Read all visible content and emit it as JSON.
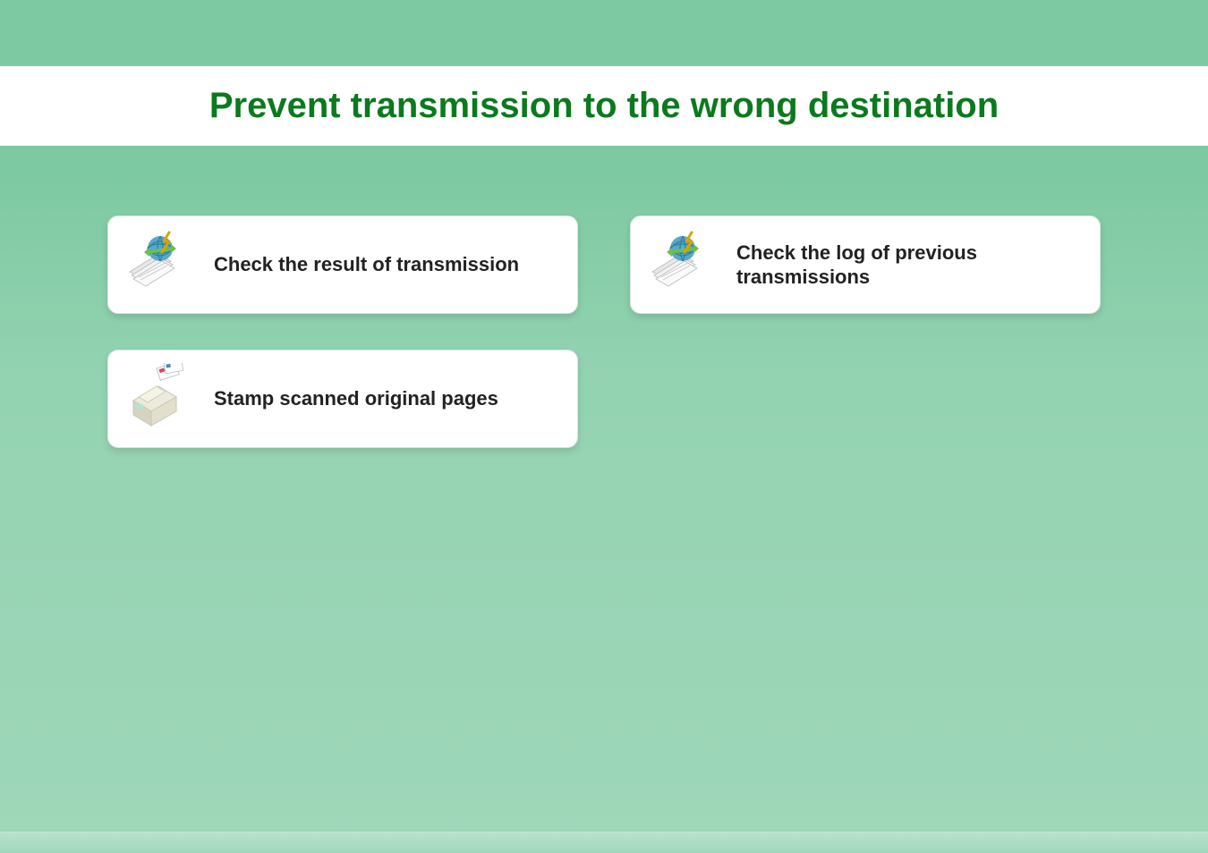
{
  "header": {
    "title": "Prevent transmission to the wrong destination"
  },
  "options": [
    {
      "label": "Check the result of transmission",
      "icon": "globe-docs"
    },
    {
      "label": "Check the log of previous transmissions",
      "icon": "globe-docs"
    },
    {
      "label": "Stamp scanned original pages",
      "icon": "printer"
    }
  ],
  "colors": {
    "accent": "#0b7a1e",
    "background_start": "#7dc9a1",
    "background_end": "#9ed7b9",
    "card_bg": "#ffffff"
  }
}
